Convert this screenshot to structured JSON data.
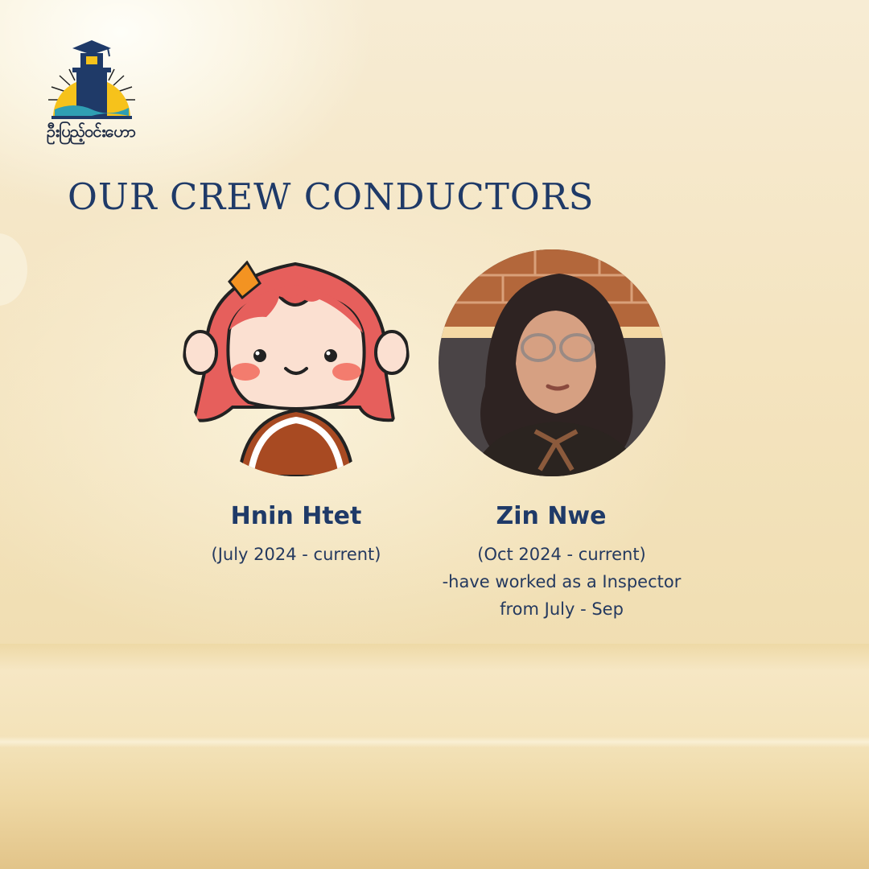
{
  "logo": {
    "text": "ဦးပြည့်ဝင်းဟော"
  },
  "title": "OUR CREW CONDUCTORS",
  "crew": [
    {
      "name": "Hnin Htet",
      "lines": [
        "(July 2024 - current)"
      ]
    },
    {
      "name": "Zin Nwe",
      "lines": [
        "(Oct 2024 - current)",
        "-have worked as a Inspector",
        "from July - Sep"
      ]
    }
  ],
  "colors": {
    "title": "#1f3a68",
    "background": "#f4e4c0",
    "avatar_hair": "#e65f5c",
    "avatar_shirt": "#a84a22"
  }
}
